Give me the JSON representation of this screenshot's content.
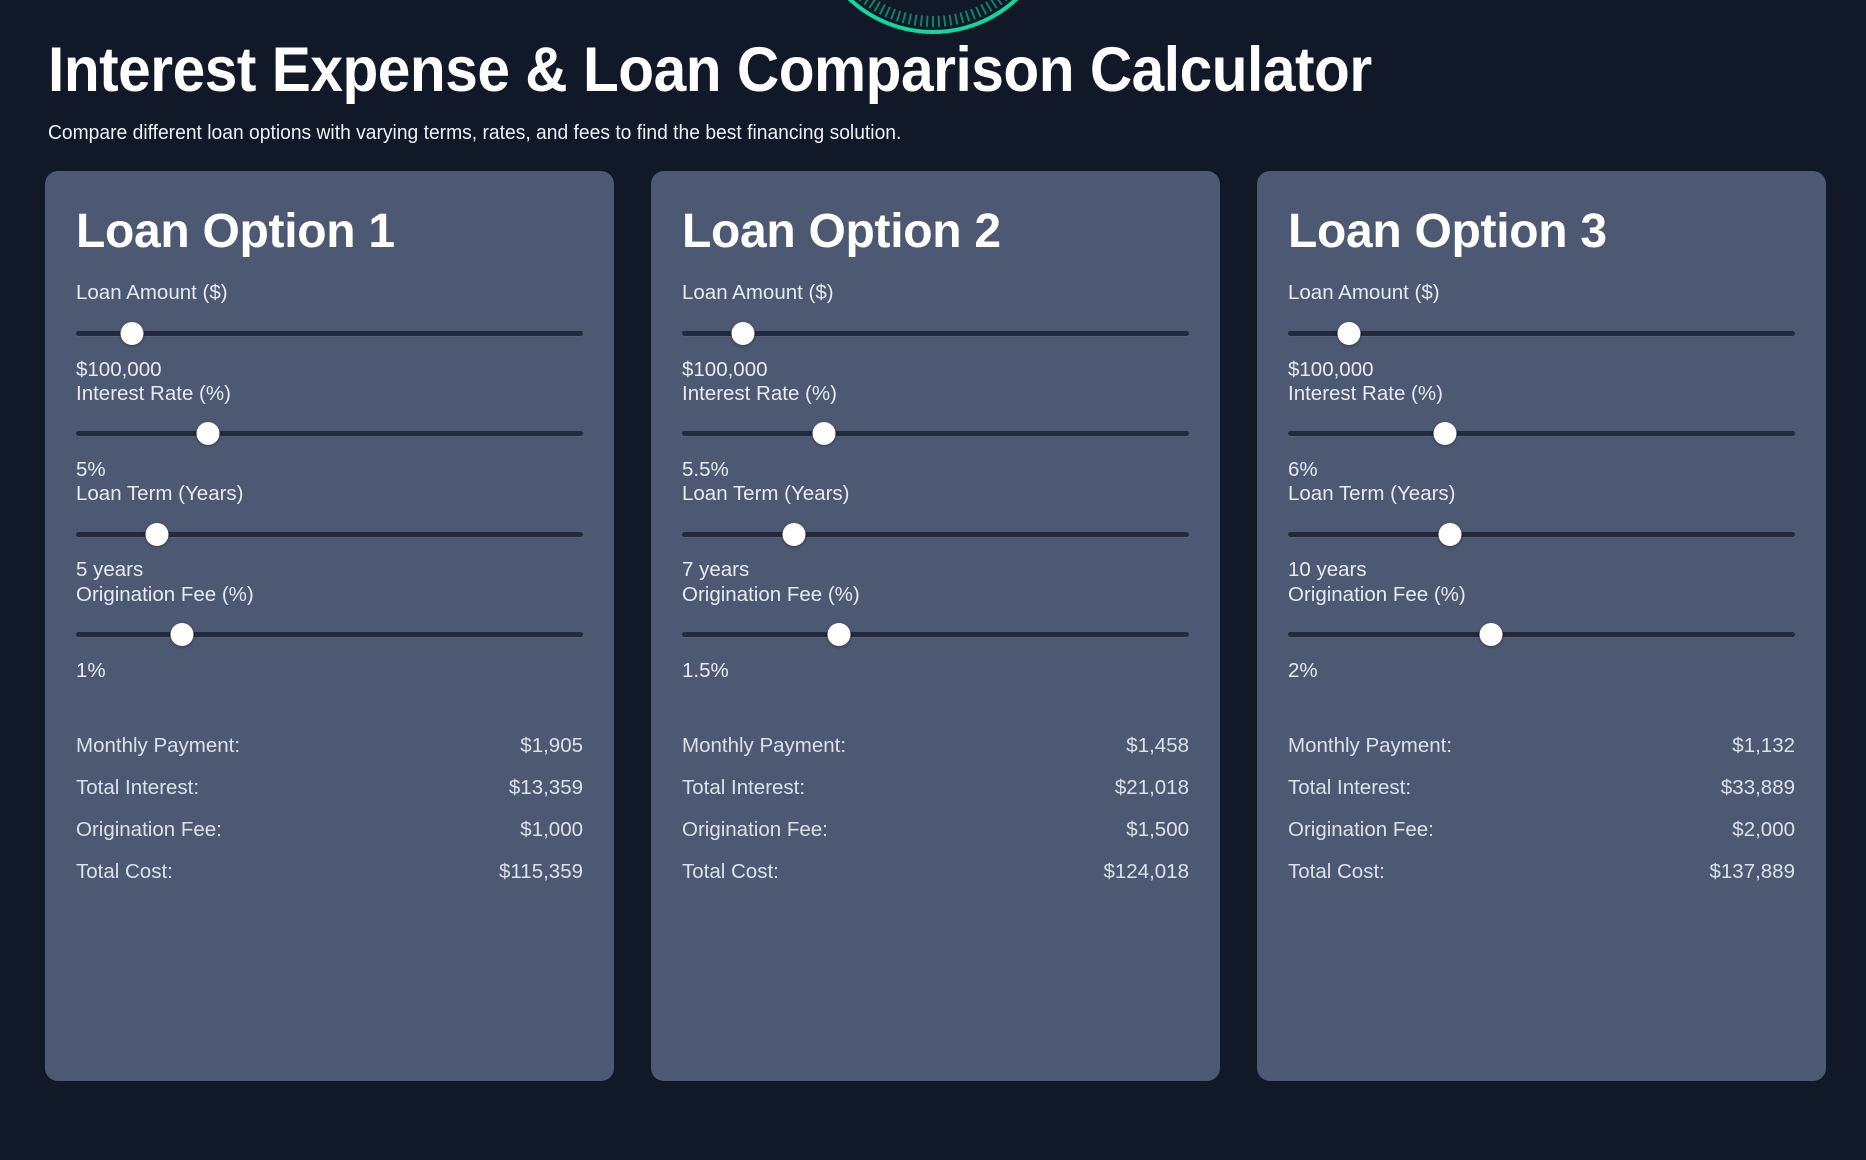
{
  "header": {
    "title": "Interest Expense & Loan Comparison Calculator",
    "subtitle": "Compare different loan options with varying terms, rates, and fees to find the best financing solution.",
    "accent_color": "#10d9a0",
    "background_color": "#111827",
    "card_color": "#4d5972"
  },
  "decor": {
    "gauge_icon": "gauge-arc"
  },
  "labels": {
    "loan_amount": "Loan Amount ($)",
    "interest_rate": "Interest Rate (%)",
    "loan_term": "Loan Term (Years)",
    "origination_fee": "Origination Fee (%)",
    "monthly_payment": "Monthly Payment:",
    "total_interest": "Total Interest:",
    "origination_fee_result": "Origination Fee:",
    "total_cost": "Total Cost:"
  },
  "cards": [
    {
      "title": "Loan Option 1",
      "loan_amount": "$100,000",
      "loan_amount_pct": 11,
      "interest_rate": "5%",
      "interest_rate_pct": 26,
      "loan_term": "5 years",
      "loan_term_pct": 16,
      "origination_fee": "1%",
      "origination_fee_pct": 21,
      "monthly_payment": "$1,905",
      "total_interest": "$13,359",
      "origination_fee_amount": "$1,000",
      "total_cost": "$115,359"
    },
    {
      "title": "Loan Option 2",
      "loan_amount": "$100,000",
      "loan_amount_pct": 12,
      "interest_rate": "5.5%",
      "interest_rate_pct": 28,
      "loan_term": "7 years",
      "loan_term_pct": 22,
      "origination_fee": "1.5%",
      "origination_fee_pct": 31,
      "monthly_payment": "$1,458",
      "total_interest": "$21,018",
      "origination_fee_amount": "$1,500",
      "total_cost": "$124,018"
    },
    {
      "title": "Loan Option 3",
      "loan_amount": "$100,000",
      "loan_amount_pct": 12,
      "interest_rate": "6%",
      "interest_rate_pct": 31,
      "loan_term": "10 years",
      "loan_term_pct": 32,
      "origination_fee": "2%",
      "origination_fee_pct": 40,
      "monthly_payment": "$1,132",
      "total_interest": "$33,889",
      "origination_fee_amount": "$2,000",
      "total_cost": "$137,889"
    }
  ]
}
